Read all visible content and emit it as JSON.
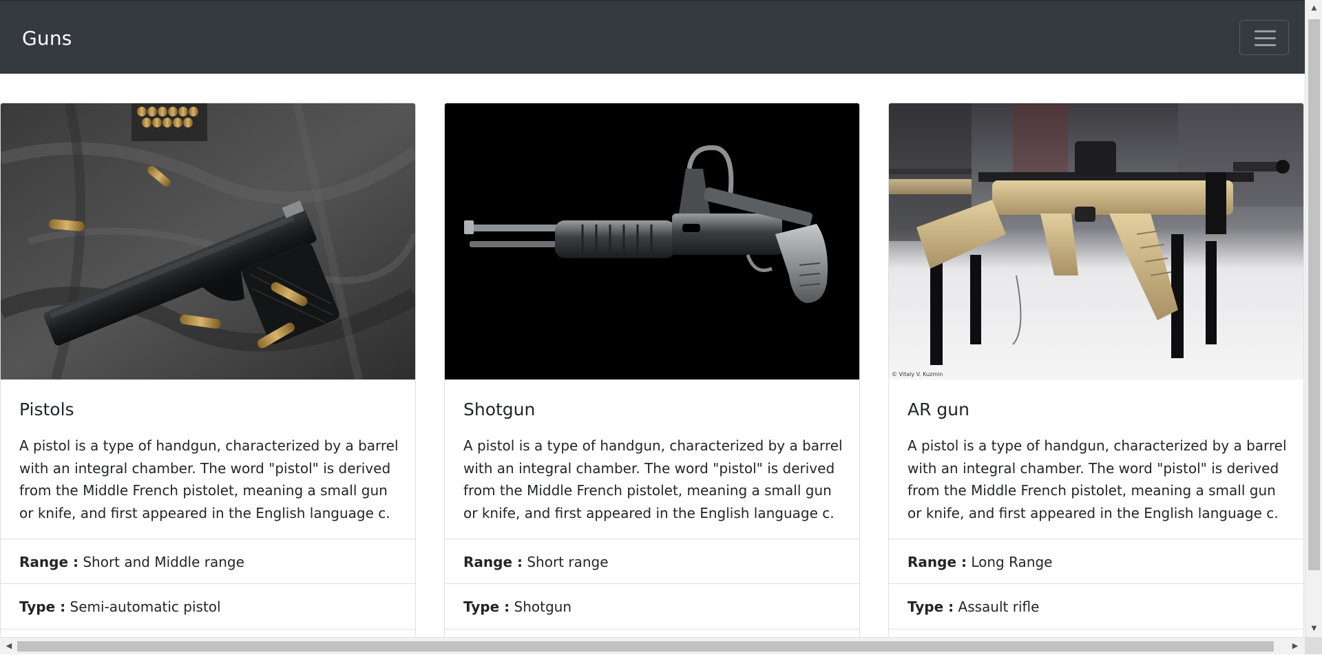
{
  "navbar": {
    "brand": "Guns",
    "toggler_icon": "hamburger-menu-icon",
    "background": "#343a40"
  },
  "cards": [
    {
      "title": "Pistols",
      "image_alt": "pistol-photo",
      "text": "A pistol is a type of handgun, characterized by a barrel with an integral chamber. The word \"pistol\" is derived from the Middle French pistolet, meaning a small gun or knife, and first appeared in the English language c.",
      "range_label": "Range :",
      "range_value": "Short and Middle range",
      "type_label": "Type :",
      "type_value": "Semi-automatic pistol"
    },
    {
      "title": "Shotgun",
      "image_alt": "shotgun-photo",
      "text": "A pistol is a type of handgun, characterized by a barrel with an integral chamber. The word \"pistol\" is derived from the Middle French pistolet, meaning a small gun or knife, and first appeared in the English language c.",
      "range_label": "Range :",
      "range_value": "Short range",
      "type_label": "Type :",
      "type_value": "Shotgun"
    },
    {
      "title": "AR gun",
      "image_alt": "ar-gun-photo",
      "text": "A pistol is a type of handgun, characterized by a barrel with an integral chamber. The word \"pistol\" is derived from the Middle French pistolet, meaning a small gun or knife, and first appeared in the English language c.",
      "range_label": "Range :",
      "range_value": "Long Range",
      "type_label": "Type :",
      "type_value": "Assault rifle",
      "image_caption": "© Vitaly V. Kuzmin"
    }
  ],
  "scrollbars": {
    "up_icon": "▲",
    "down_icon": "▼",
    "left_icon": "◀",
    "right_icon": "▶"
  }
}
